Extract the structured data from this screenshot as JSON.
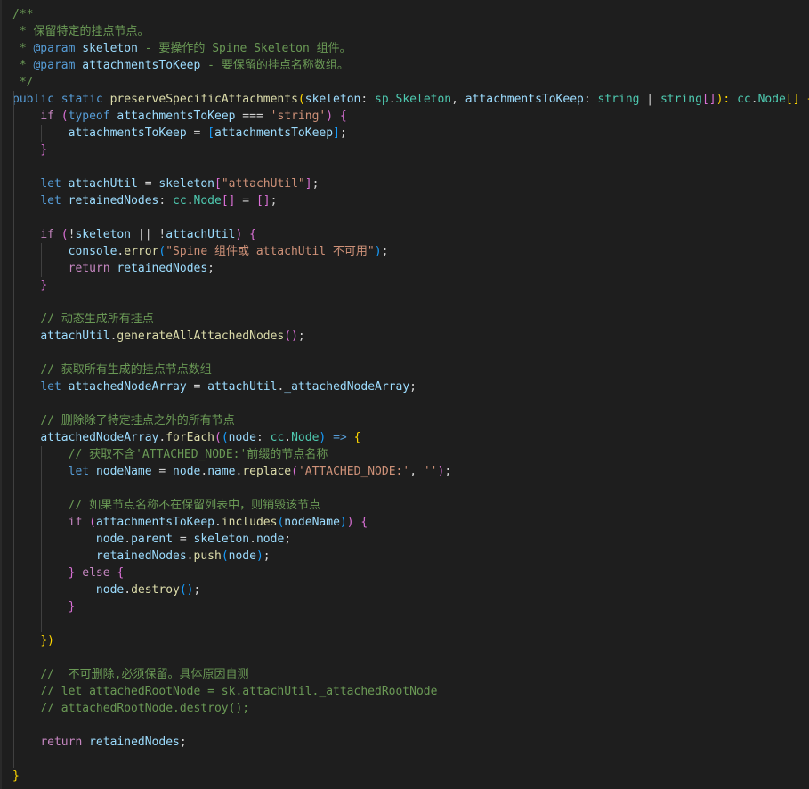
{
  "editor": {
    "lines": [
      [
        [
          "/**",
          "c-comment"
        ]
      ],
      [
        [
          " * 保留特定的挂点节点。",
          "c-comment"
        ]
      ],
      [
        [
          " * ",
          "c-comment"
        ],
        [
          "@param",
          "c-tag"
        ],
        [
          " ",
          "c-comment"
        ],
        [
          "skeleton",
          "c-var"
        ],
        [
          " - 要操作的 Spine Skeleton 组件。",
          "c-comment"
        ]
      ],
      [
        [
          " * ",
          "c-comment"
        ],
        [
          "@param",
          "c-tag"
        ],
        [
          " ",
          "c-comment"
        ],
        [
          "attachmentsToKeep",
          "c-var"
        ],
        [
          " - 要保留的挂点名称数组。",
          "c-comment"
        ]
      ],
      [
        [
          " */",
          "c-comment"
        ]
      ],
      [
        [
          "public",
          "c-keyword"
        ],
        [
          " ",
          "c-plain"
        ],
        [
          "static",
          "c-keyword"
        ],
        [
          " ",
          "c-plain"
        ],
        [
          "preserveSpecificAttachments",
          "c-func"
        ],
        [
          "(",
          "c-b1"
        ],
        [
          "skeleton",
          "c-var"
        ],
        [
          ": ",
          "c-plain"
        ],
        [
          "sp",
          "c-type"
        ],
        [
          ".",
          "c-plain"
        ],
        [
          "Skeleton",
          "c-type"
        ],
        [
          ", ",
          "c-plain"
        ],
        [
          "attachmentsToKeep",
          "c-var"
        ],
        [
          ": ",
          "c-plain"
        ],
        [
          "string",
          "c-type"
        ],
        [
          " | ",
          "c-plain"
        ],
        [
          "string",
          "c-type"
        ],
        [
          "[]",
          "c-b2"
        ],
        [
          "): ",
          "c-b1"
        ],
        [
          "cc",
          "c-type"
        ],
        [
          ".",
          "c-plain"
        ],
        [
          "Node",
          "c-type"
        ],
        [
          "[]",
          "c-b1"
        ],
        [
          " {",
          "c-b1"
        ]
      ],
      [
        [
          "    ",
          "c-plain"
        ],
        [
          "if",
          "c-control"
        ],
        [
          " ",
          "c-plain"
        ],
        [
          "(",
          "c-b2"
        ],
        [
          "typeof",
          "c-keyword"
        ],
        [
          " ",
          "c-plain"
        ],
        [
          "attachmentsToKeep",
          "c-var"
        ],
        [
          " === ",
          "c-plain"
        ],
        [
          "'string'",
          "c-string"
        ],
        [
          ") {",
          "c-b2"
        ]
      ],
      [
        [
          "        ",
          "c-plain"
        ],
        [
          "attachmentsToKeep",
          "c-var"
        ],
        [
          " = ",
          "c-plain"
        ],
        [
          "[",
          "c-b3"
        ],
        [
          "attachmentsToKeep",
          "c-var"
        ],
        [
          "]",
          "c-b3"
        ],
        [
          ";",
          "c-plain"
        ]
      ],
      [
        [
          "    ",
          "c-plain"
        ],
        [
          "}",
          "c-b2"
        ]
      ],
      [
        [
          "",
          "c-plain"
        ]
      ],
      [
        [
          "    ",
          "c-plain"
        ],
        [
          "let",
          "c-keyword"
        ],
        [
          " ",
          "c-plain"
        ],
        [
          "attachUtil",
          "c-var"
        ],
        [
          " = ",
          "c-plain"
        ],
        [
          "skeleton",
          "c-var"
        ],
        [
          "[",
          "c-b2"
        ],
        [
          "\"attachUtil\"",
          "c-string"
        ],
        [
          "]",
          "c-b2"
        ],
        [
          ";",
          "c-plain"
        ]
      ],
      [
        [
          "    ",
          "c-plain"
        ],
        [
          "let",
          "c-keyword"
        ],
        [
          " ",
          "c-plain"
        ],
        [
          "retainedNodes",
          "c-var"
        ],
        [
          ": ",
          "c-plain"
        ],
        [
          "cc",
          "c-type"
        ],
        [
          ".",
          "c-plain"
        ],
        [
          "Node",
          "c-type"
        ],
        [
          "[]",
          "c-b2"
        ],
        [
          " = ",
          "c-plain"
        ],
        [
          "[]",
          "c-b2"
        ],
        [
          ";",
          "c-plain"
        ]
      ],
      [
        [
          "",
          "c-plain"
        ]
      ],
      [
        [
          "    ",
          "c-plain"
        ],
        [
          "if",
          "c-control"
        ],
        [
          " ",
          "c-plain"
        ],
        [
          "(",
          "c-b2"
        ],
        [
          "!",
          "c-plain"
        ],
        [
          "skeleton",
          "c-var"
        ],
        [
          " || !",
          "c-plain"
        ],
        [
          "attachUtil",
          "c-var"
        ],
        [
          ") {",
          "c-b2"
        ]
      ],
      [
        [
          "        ",
          "c-plain"
        ],
        [
          "console",
          "c-var"
        ],
        [
          ".",
          "c-plain"
        ],
        [
          "error",
          "c-func"
        ],
        [
          "(",
          "c-b3"
        ],
        [
          "\"Spine 组件或 attachUtil 不可用\"",
          "c-string"
        ],
        [
          ")",
          "c-b3"
        ],
        [
          ";",
          "c-plain"
        ]
      ],
      [
        [
          "        ",
          "c-plain"
        ],
        [
          "return",
          "c-control"
        ],
        [
          " ",
          "c-plain"
        ],
        [
          "retainedNodes",
          "c-var"
        ],
        [
          ";",
          "c-plain"
        ]
      ],
      [
        [
          "    ",
          "c-plain"
        ],
        [
          "}",
          "c-b2"
        ]
      ],
      [
        [
          "",
          "c-plain"
        ]
      ],
      [
        [
          "    ",
          "c-plain"
        ],
        [
          "// 动态生成所有挂点",
          "c-comment"
        ]
      ],
      [
        [
          "    ",
          "c-plain"
        ],
        [
          "attachUtil",
          "c-var"
        ],
        [
          ".",
          "c-plain"
        ],
        [
          "generateAllAttachedNodes",
          "c-func"
        ],
        [
          "()",
          "c-b2"
        ],
        [
          ";",
          "c-plain"
        ]
      ],
      [
        [
          "",
          "c-plain"
        ]
      ],
      [
        [
          "    ",
          "c-plain"
        ],
        [
          "// 获取所有生成的挂点节点数组",
          "c-comment"
        ]
      ],
      [
        [
          "    ",
          "c-plain"
        ],
        [
          "let",
          "c-keyword"
        ],
        [
          " ",
          "c-plain"
        ],
        [
          "attachedNodeArray",
          "c-var"
        ],
        [
          " = ",
          "c-plain"
        ],
        [
          "attachUtil",
          "c-var"
        ],
        [
          ".",
          "c-plain"
        ],
        [
          "_attachedNodeArray",
          "c-var"
        ],
        [
          ";",
          "c-plain"
        ]
      ],
      [
        [
          "",
          "c-plain"
        ]
      ],
      [
        [
          "    ",
          "c-plain"
        ],
        [
          "// 删除除了特定挂点之外的所有节点",
          "c-comment"
        ]
      ],
      [
        [
          "    ",
          "c-plain"
        ],
        [
          "attachedNodeArray",
          "c-var"
        ],
        [
          ".",
          "c-plain"
        ],
        [
          "forEach",
          "c-func"
        ],
        [
          "(",
          "c-b2"
        ],
        [
          "(",
          "c-b3"
        ],
        [
          "node",
          "c-var"
        ],
        [
          ": ",
          "c-plain"
        ],
        [
          "cc",
          "c-type"
        ],
        [
          ".",
          "c-plain"
        ],
        [
          "Node",
          "c-type"
        ],
        [
          ")",
          "c-b3"
        ],
        [
          " => ",
          "c-keyword"
        ],
        [
          "{",
          "c-b1"
        ]
      ],
      [
        [
          "        ",
          "c-plain"
        ],
        [
          "// 获取不含'ATTACHED_NODE:'前缀的节点名称",
          "c-comment"
        ]
      ],
      [
        [
          "        ",
          "c-plain"
        ],
        [
          "let",
          "c-keyword"
        ],
        [
          " ",
          "c-plain"
        ],
        [
          "nodeName",
          "c-var"
        ],
        [
          " = ",
          "c-plain"
        ],
        [
          "node",
          "c-var"
        ],
        [
          ".",
          "c-plain"
        ],
        [
          "name",
          "c-var"
        ],
        [
          ".",
          "c-plain"
        ],
        [
          "replace",
          "c-func"
        ],
        [
          "(",
          "c-b2"
        ],
        [
          "'ATTACHED_NODE:'",
          "c-string"
        ],
        [
          ", ",
          "c-plain"
        ],
        [
          "''",
          "c-string"
        ],
        [
          ")",
          "c-b2"
        ],
        [
          ";",
          "c-plain"
        ]
      ],
      [
        [
          "",
          "c-plain"
        ]
      ],
      [
        [
          "        ",
          "c-plain"
        ],
        [
          "// 如果节点名称不在保留列表中，则销毁该节点",
          "c-comment"
        ]
      ],
      [
        [
          "        ",
          "c-plain"
        ],
        [
          "if",
          "c-control"
        ],
        [
          " ",
          "c-plain"
        ],
        [
          "(",
          "c-b2"
        ],
        [
          "attachmentsToKeep",
          "c-var"
        ],
        [
          ".",
          "c-plain"
        ],
        [
          "includes",
          "c-func"
        ],
        [
          "(",
          "c-b3"
        ],
        [
          "nodeName",
          "c-var"
        ],
        [
          ")",
          "c-b3"
        ],
        [
          ") {",
          "c-b2"
        ]
      ],
      [
        [
          "            ",
          "c-plain"
        ],
        [
          "node",
          "c-var"
        ],
        [
          ".",
          "c-plain"
        ],
        [
          "parent",
          "c-var"
        ],
        [
          " = ",
          "c-plain"
        ],
        [
          "skeleton",
          "c-var"
        ],
        [
          ".",
          "c-plain"
        ],
        [
          "node",
          "c-var"
        ],
        [
          ";",
          "c-plain"
        ]
      ],
      [
        [
          "            ",
          "c-plain"
        ],
        [
          "retainedNodes",
          "c-var"
        ],
        [
          ".",
          "c-plain"
        ],
        [
          "push",
          "c-func"
        ],
        [
          "(",
          "c-b3"
        ],
        [
          "node",
          "c-var"
        ],
        [
          ")",
          "c-b3"
        ],
        [
          ";",
          "c-plain"
        ]
      ],
      [
        [
          "        ",
          "c-plain"
        ],
        [
          "} ",
          "c-b2"
        ],
        [
          "else",
          "c-control"
        ],
        [
          " {",
          "c-b2"
        ]
      ],
      [
        [
          "            ",
          "c-plain"
        ],
        [
          "node",
          "c-var"
        ],
        [
          ".",
          "c-plain"
        ],
        [
          "destroy",
          "c-func"
        ],
        [
          "()",
          "c-b3"
        ],
        [
          ";",
          "c-plain"
        ]
      ],
      [
        [
          "        ",
          "c-plain"
        ],
        [
          "}",
          "c-b2"
        ]
      ],
      [
        [
          "",
          "c-plain"
        ]
      ],
      [
        [
          "    ",
          "c-plain"
        ],
        [
          "})",
          "c-b1"
        ]
      ],
      [
        [
          "",
          "c-plain"
        ]
      ],
      [
        [
          "    ",
          "c-plain"
        ],
        [
          "//  不可删除,必须保留。具体原因自测",
          "c-comment"
        ]
      ],
      [
        [
          "    ",
          "c-plain"
        ],
        [
          "// let attachedRootNode = sk.attachUtil._attachedRootNode",
          "c-comment"
        ]
      ],
      [
        [
          "    ",
          "c-plain"
        ],
        [
          "// attachedRootNode.destroy();",
          "c-comment"
        ]
      ],
      [
        [
          "",
          "c-plain"
        ]
      ],
      [
        [
          "    ",
          "c-plain"
        ],
        [
          "return",
          "c-control"
        ],
        [
          " ",
          "c-plain"
        ],
        [
          "retainedNodes",
          "c-var"
        ],
        [
          ";",
          "c-plain"
        ]
      ],
      [
        [
          "",
          "c-plain"
        ]
      ],
      [
        [
          "}",
          "c-b1"
        ]
      ]
    ]
  }
}
